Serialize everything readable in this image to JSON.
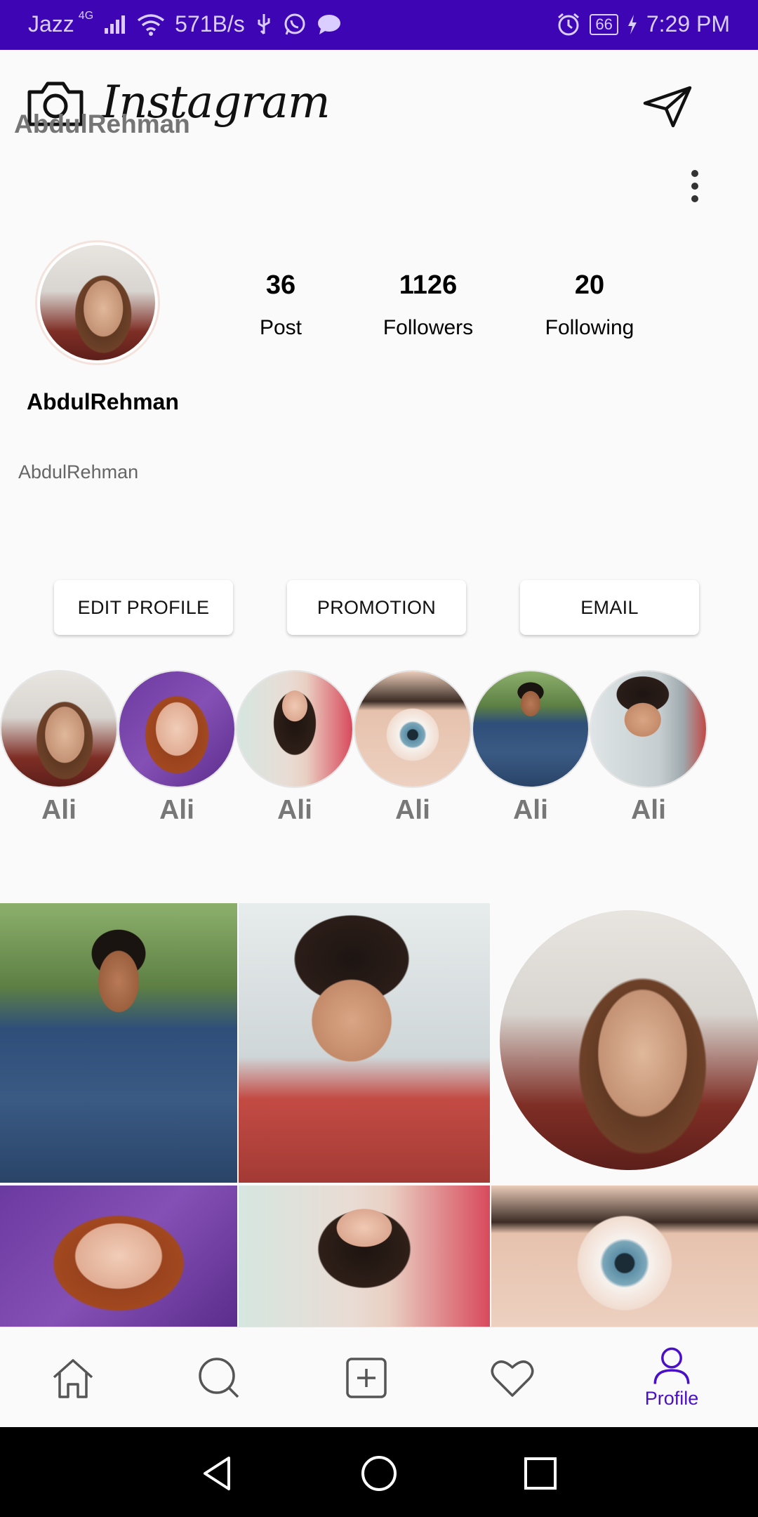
{
  "status_bar": {
    "carrier": "Jazz",
    "network": "4G",
    "speed": "571B/s",
    "battery": "66",
    "time": "7:29 PM",
    "background": "#3d05b3"
  },
  "header": {
    "brand": "Instagram",
    "username": "AbdulRehman",
    "icons": [
      "camera-icon",
      "send-icon",
      "more-vert-icon"
    ]
  },
  "profile": {
    "display_name": "AbdulRehman",
    "bio": "AbdulRehman",
    "stats": [
      {
        "value": "36",
        "label": "Post"
      },
      {
        "value": "1126",
        "label": "Followers"
      },
      {
        "value": "20",
        "label": "Following"
      }
    ]
  },
  "actions": {
    "edit_profile": "EDIT PROFILE",
    "promotion": "PROMOTION",
    "email": "EMAIL"
  },
  "highlights": [
    {
      "label": "Ali",
      "photo": "girl-laptop"
    },
    {
      "label": "Ali",
      "photo": "girl-purple-scarf"
    },
    {
      "label": "Ali",
      "photo": "girl-pink-dress"
    },
    {
      "label": "Ali",
      "photo": "eye-closeup"
    },
    {
      "label": "Ali",
      "photo": "man-plaid-shirt"
    },
    {
      "label": "Ali",
      "photo": "man-red-shirt"
    }
  ],
  "grid": [
    {
      "photo": "man-plaid-shirt"
    },
    {
      "photo": "man-red-shirt"
    },
    {
      "photo": "girl-laptop-circle"
    },
    {
      "photo": "girl-purple-scarf"
    },
    {
      "photo": "girl-pink-dress"
    },
    {
      "photo": "eye-closeup"
    }
  ],
  "bottom_nav": {
    "items": [
      "home-icon",
      "search-icon",
      "add-post-icon",
      "heart-icon",
      "profile-icon"
    ],
    "active_label": "Profile",
    "accent": "#4a10c9"
  }
}
